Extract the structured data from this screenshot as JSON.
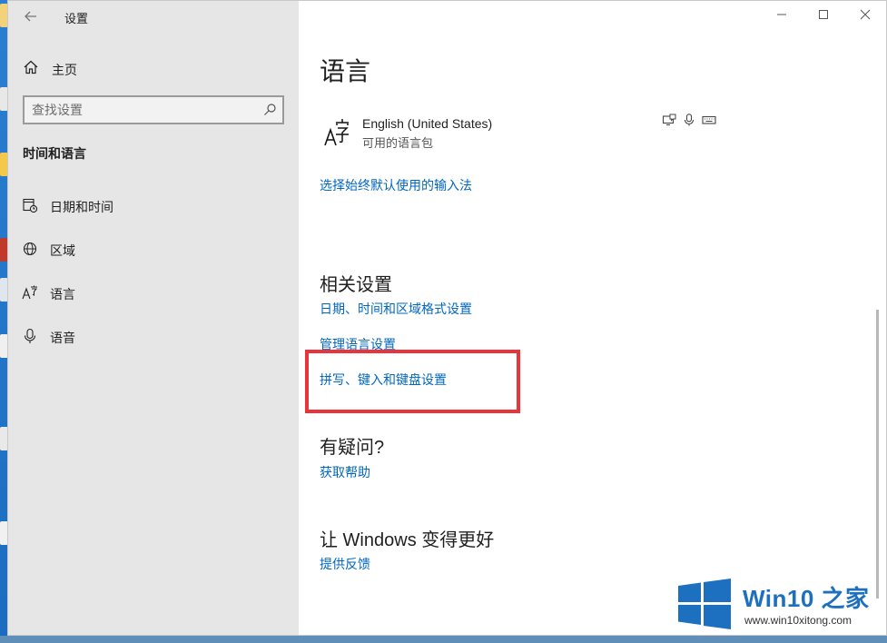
{
  "window": {
    "title": "设置",
    "controls": {
      "minimize": "—",
      "maximize": "☐",
      "close": "✕"
    }
  },
  "sidebar": {
    "home_label": "主页",
    "search_placeholder": "查找设置",
    "section_title": "时间和语言",
    "items": [
      {
        "label": "日期和时间",
        "icon": "calendar-icon"
      },
      {
        "label": "区域",
        "icon": "globe-icon"
      },
      {
        "label": "语言",
        "icon": "language-icon"
      },
      {
        "label": "语音",
        "icon": "microphone-icon"
      }
    ]
  },
  "main": {
    "title": "语言",
    "language": {
      "name": "English (United States)",
      "status": "可用的语言包",
      "feature_icons": [
        "display-speech-icon",
        "microphone-icon",
        "keyboard-icon"
      ]
    },
    "input_method_link": "选择始终默认使用的输入法",
    "related_settings": {
      "heading": "相关设置",
      "links": [
        "日期、时间和区域格式设置",
        "管理语言设置",
        "拼写、键入和键盘设置"
      ]
    },
    "help": {
      "heading": "有疑问?",
      "link": "获取帮助"
    },
    "feedback": {
      "heading": "让 Windows 变得更好",
      "link": "提供反馈"
    }
  },
  "watermark": {
    "brand": "Win10 之家",
    "url": "www.win10xitong.com"
  },
  "colors": {
    "link": "#0067c0",
    "highlight": "#e8343a",
    "sidebar_bg": "#e6e6e6"
  }
}
